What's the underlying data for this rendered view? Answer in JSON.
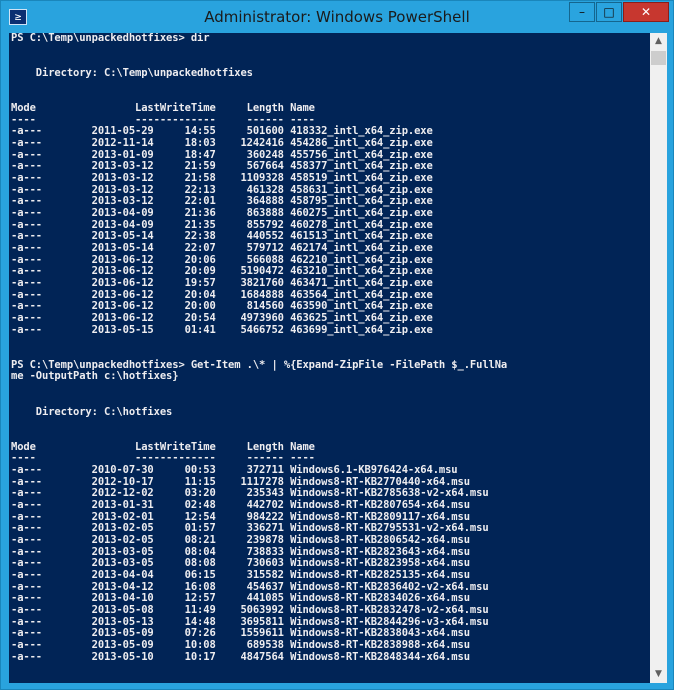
{
  "window": {
    "title": "Administrator: Windows PowerShell",
    "app_icon": "powershell-icon",
    "icon_glyph": "≥",
    "minimize_glyph": "–",
    "maximize_glyph": "□",
    "close_glyph": "✕"
  },
  "scrollbar": {
    "up_glyph": "▲",
    "down_glyph": "▼"
  },
  "colors": {
    "console_bg": "#012456",
    "console_text": "#eeedf0",
    "titlebar": "#29a3de",
    "close_button": "#c7372f"
  },
  "console": {
    "lines": [
      "PS C:\\Temp\\unpackedhotfixes> dir",
      "",
      "",
      "    Directory: C:\\Temp\\unpackedhotfixes",
      "",
      "",
      "Mode                LastWriteTime     Length Name",
      "----                -------------     ------ ----",
      "-a---        2011-05-29     14:55     501600 418332_intl_x64_zip.exe",
      "-a---        2012-11-14     18:03    1242416 454286_intl_x64_zip.exe",
      "-a---        2013-01-09     18:47     360248 455756_intl_x64_zip.exe",
      "-a---        2013-03-12     21:59     567664 458377_intl_x64_zip.exe",
      "-a---        2013-03-12     21:58    1109328 458519_intl_x64_zip.exe",
      "-a---        2013-03-12     22:13     461328 458631_intl_x64_zip.exe",
      "-a---        2013-03-12     22:01     364888 458795_intl_x64_zip.exe",
      "-a---        2013-04-09     21:36     863888 460275_intl_x64_zip.exe",
      "-a---        2013-04-09     21:35     855792 460278_intl_x64_zip.exe",
      "-a---        2013-05-14     22:38     440552 461513_intl_x64_zip.exe",
      "-a---        2013-05-14     22:07     579712 462174_intl_x64_zip.exe",
      "-a---        2013-06-12     20:06     566088 462210_intl_x64_zip.exe",
      "-a---        2013-06-12     20:09    5190472 463210_intl_x64_zip.exe",
      "-a---        2013-06-12     19:57    3821760 463471_intl_x64_zip.exe",
      "-a---        2013-06-12     20:04    1684888 463564_intl_x64_zip.exe",
      "-a---        2013-06-12     20:00     814560 463590_intl_x64_zip.exe",
      "-a---        2013-06-12     20:54    4973960 463625_intl_x64_zip.exe",
      "-a---        2013-05-15     01:41    5466752 463699_intl_x64_zip.exe",
      "",
      "",
      "PS C:\\Temp\\unpackedhotfixes> Get-Item .\\* | %{Expand-ZipFile -FilePath $_.FullNa",
      "me -OutputPath c:\\hotfixes}",
      "",
      "",
      "    Directory: C:\\hotfixes",
      "",
      "",
      "Mode                LastWriteTime     Length Name",
      "----                -------------     ------ ----",
      "-a---        2010-07-30     00:53     372711 Windows6.1-KB976424-x64.msu",
      "-a---        2012-10-17     11:15    1117278 Windows8-RT-KB2770440-x64.msu",
      "-a---        2012-12-02     03:20     235343 Windows8-RT-KB2785638-v2-x64.msu",
      "-a---        2013-01-31     02:48     442702 Windows8-RT-KB2807654-x64.msu",
      "-a---        2013-02-01     12:54     984222 Windows8-RT-KB2809117-x64.msu",
      "-a---        2013-02-05     01:57     336271 Windows8-RT-KB2795531-v2-x64.msu",
      "-a---        2013-02-05     08:21     239878 Windows8-RT-KB2806542-x64.msu",
      "-a---        2013-03-05     08:04     738833 Windows8-RT-KB2823643-x64.msu",
      "-a---        2013-03-05     08:08     730603 Windows8-RT-KB2823958-x64.msu",
      "-a---        2013-04-04     06:15     315582 Windows8-RT-KB2825135-x64.msu",
      "-a---        2013-04-12     16:08     454637 Windows8-RT-KB2836402-v2-x64.msu",
      "-a---        2013-04-10     12:57     441085 Windows8-RT-KB2834026-x64.msu",
      "-a---        2013-05-08     11:49    5063992 Windows8-RT-KB2832478-v2-x64.msu",
      "-a---        2013-05-13     14:48    3695811 Windows8-RT-KB2844296-v3-x64.msu",
      "-a---        2013-05-09     07:26    1559611 Windows8-RT-KB2838043-x64.msu",
      "-a---        2013-05-09     10:08     689538 Windows8-RT-KB2838988-x64.msu",
      "-a---        2013-05-10     10:17    4847564 Windows8-RT-KB2848344-x64.msu"
    ]
  }
}
